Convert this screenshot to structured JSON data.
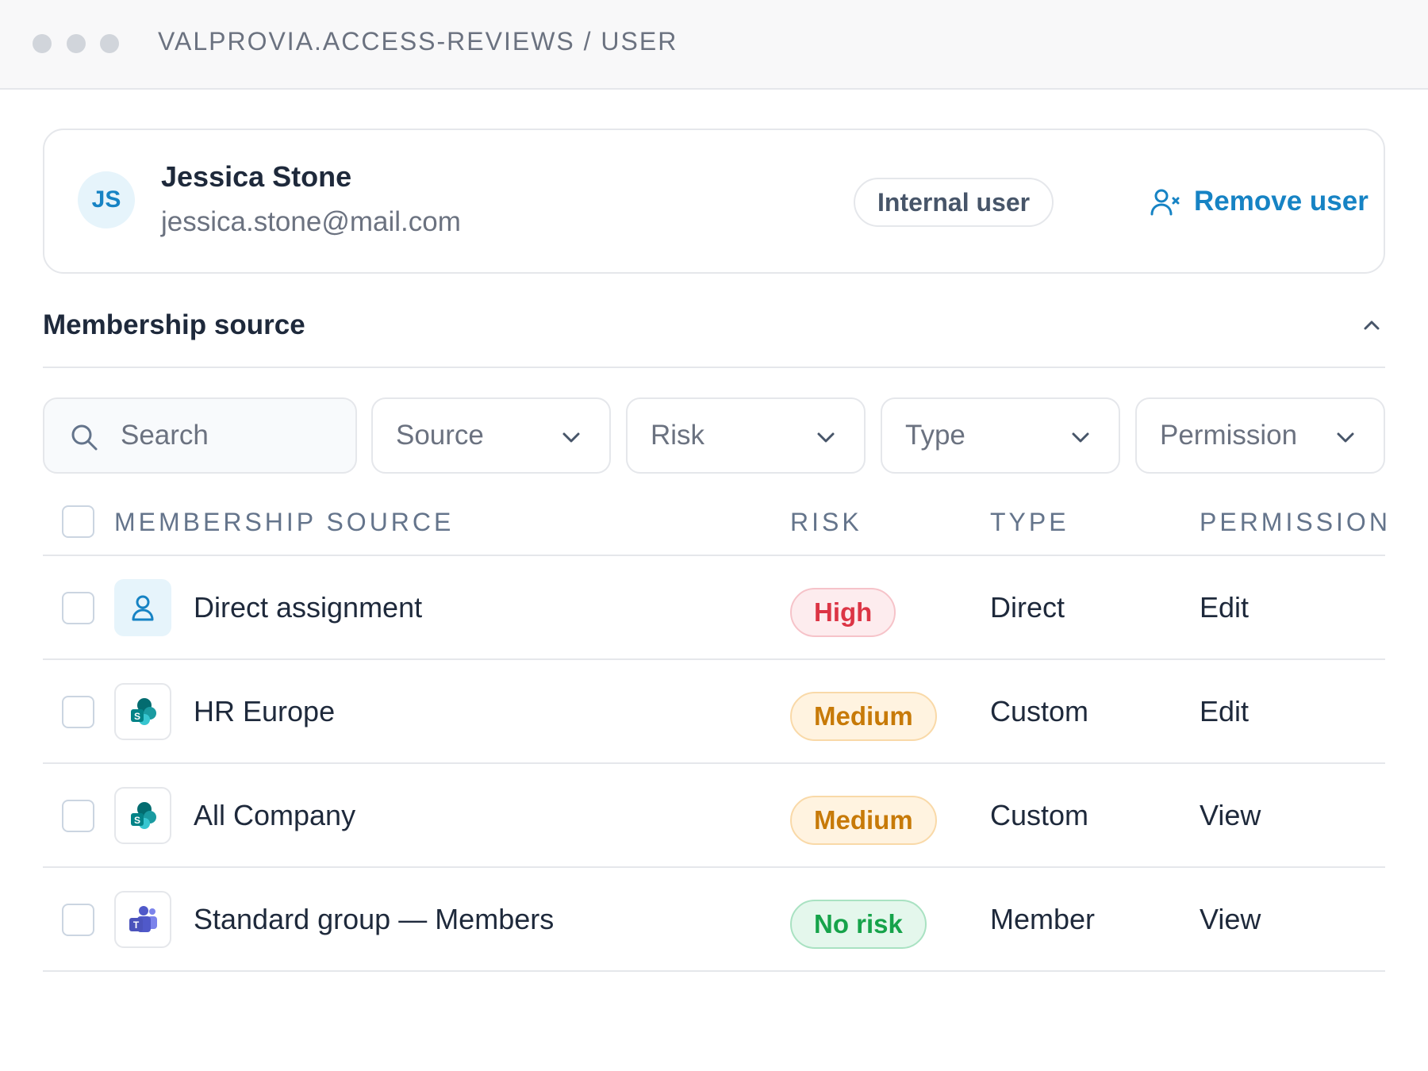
{
  "window": {
    "breadcrumb": "VALPROVIA.ACCESS-REVIEWS / USER"
  },
  "user": {
    "initials": "JS",
    "name": "Jessica Stone",
    "email": "jessica.stone@mail.com",
    "badge": "Internal user",
    "remove_label": "Remove user"
  },
  "section": {
    "title": "Membership source"
  },
  "filters": {
    "search_placeholder": "Search",
    "source": "Source",
    "risk": "Risk",
    "type": "Type",
    "permission": "Permission"
  },
  "table": {
    "headers": {
      "source": "MEMBERSHIP SOURCE",
      "risk": "RISK",
      "type": "TYPE",
      "permission": "PERMISSION"
    },
    "rows": [
      {
        "icon": "user-icon",
        "source": "Direct assignment",
        "risk": "High",
        "risk_level": "high",
        "type": "Direct",
        "permission": "Edit"
      },
      {
        "icon": "sharepoint-icon",
        "source": "HR Europe",
        "risk": "Medium",
        "risk_level": "medium",
        "type": "Custom",
        "permission": "Edit"
      },
      {
        "icon": "sharepoint-icon",
        "source": "All Company",
        "risk": "Medium",
        "risk_level": "medium",
        "type": "Custom",
        "permission": "View"
      },
      {
        "icon": "teams-icon",
        "source": "Standard group — Members",
        "risk": "No risk",
        "risk_level": "none",
        "type": "Member",
        "permission": "View"
      }
    ]
  },
  "colors": {
    "accent": "#1683c4",
    "risk_high": {
      "bg": "#fdecee",
      "border": "#f6c3c9",
      "text": "#dc3545"
    },
    "risk_medium": {
      "bg": "#fff3e0",
      "border": "#f9d9a8",
      "text": "#c77a08"
    },
    "risk_none": {
      "bg": "#e4f7ec",
      "border": "#a9e2c2",
      "text": "#16a34a"
    }
  }
}
